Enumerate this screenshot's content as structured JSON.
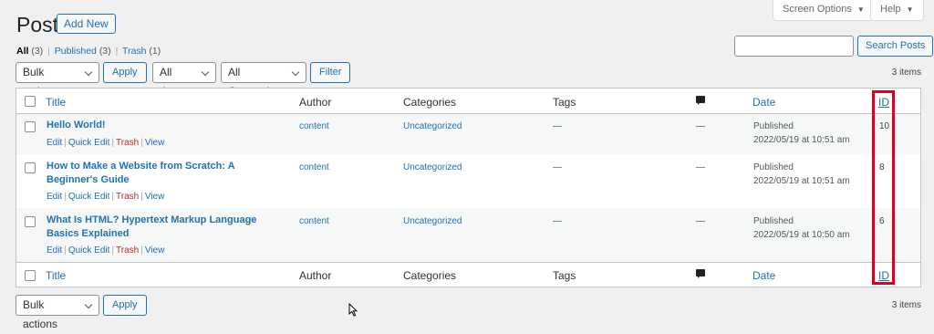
{
  "header": {
    "title": "Posts",
    "add_new": "Add New",
    "screen_options": "Screen Options",
    "help": "Help"
  },
  "views": {
    "all": "All",
    "all_count": "(3)",
    "published": "Published",
    "published_count": "(3)",
    "trash": "Trash",
    "trash_count": "(1)",
    "separator": "|"
  },
  "search": {
    "button": "Search Posts",
    "value": ""
  },
  "filters": {
    "bulk_actions": "Bulk actions",
    "apply": "Apply",
    "dates": "All dates",
    "categories": "All Categories",
    "filter": "Filter"
  },
  "items_count": "3 items",
  "columns": {
    "title": "Title",
    "author": "Author",
    "categories": "Categories",
    "tags": "Tags",
    "date": "Date",
    "id": "ID"
  },
  "row_actions": {
    "edit": "Edit",
    "quick_edit": "Quick Edit",
    "trash": "Trash",
    "view": "View"
  },
  "posts": [
    {
      "title": "Hello World!",
      "author": "content",
      "category": "Uncategorized",
      "tags": "—",
      "comments": "—",
      "status": "Published",
      "date": "2022/05/19 at 10:51 am",
      "id": "10"
    },
    {
      "title": "How to Make a Website from Scratch: A Beginner's Guide",
      "author": "content",
      "category": "Uncategorized",
      "tags": "—",
      "comments": "—",
      "status": "Published",
      "date": "2022/05/19 at 10:51 am",
      "id": "8"
    },
    {
      "title": "What Is HTML? Hypertext Markup Language Basics Explained",
      "author": "content",
      "category": "Uncategorized",
      "tags": "—",
      "comments": "—",
      "status": "Published",
      "date": "2022/05/19 at 10:50 am",
      "id": "6"
    }
  ],
  "colors": {
    "accent": "#2271b1",
    "highlight": "#e0001b",
    "trash": "#b32d2e"
  }
}
